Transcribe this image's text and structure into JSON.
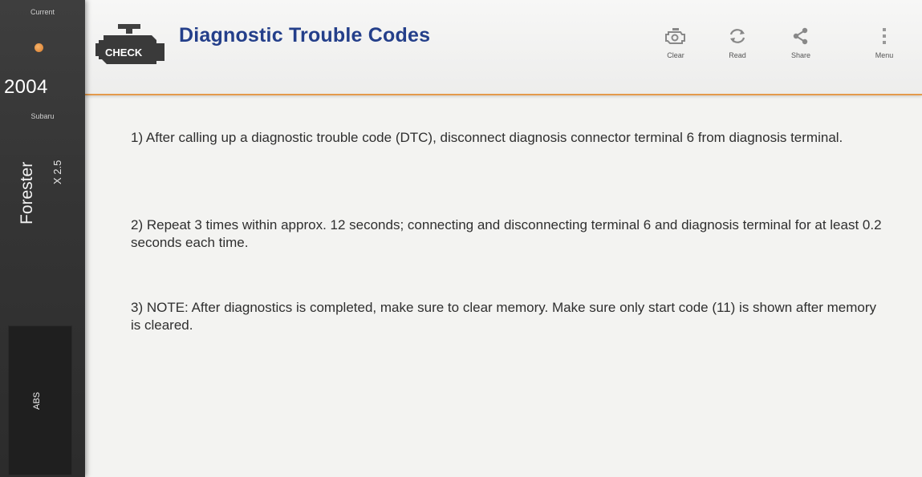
{
  "sidebar": {
    "current_label": "Current",
    "year": "2004",
    "make": "Subaru",
    "model": "Forester",
    "trim": "X 2.5",
    "section_tab": "ABS",
    "accent_color": "#e08a3c"
  },
  "header": {
    "icon_label": "CHECK",
    "title": "Diagnostic Trouble Codes",
    "title_color": "#243f8a",
    "underline_color": "#e49a4c",
    "actions": [
      {
        "label": "Clear",
        "icon": "engine-clear-icon"
      },
      {
        "label": "Read",
        "icon": "refresh-icon"
      },
      {
        "label": "Share",
        "icon": "share-icon"
      },
      {
        "label": "Menu",
        "icon": "overflow-menu-icon"
      }
    ]
  },
  "content": {
    "paragraphs": [
      "1) After calling up a diagnostic trouble code (DTC), disconnect diagnosis connector terminal 6 from diagnosis terminal.",
      "2) Repeat 3 times within approx. 12 seconds; connecting and disconnecting terminal 6 and diagnosis terminal for at least 0.2 seconds each time.",
      "3) NOTE: After diagnostics is completed, make sure to clear memory. Make sure only start code (11) is shown after memory is cleared."
    ]
  }
}
